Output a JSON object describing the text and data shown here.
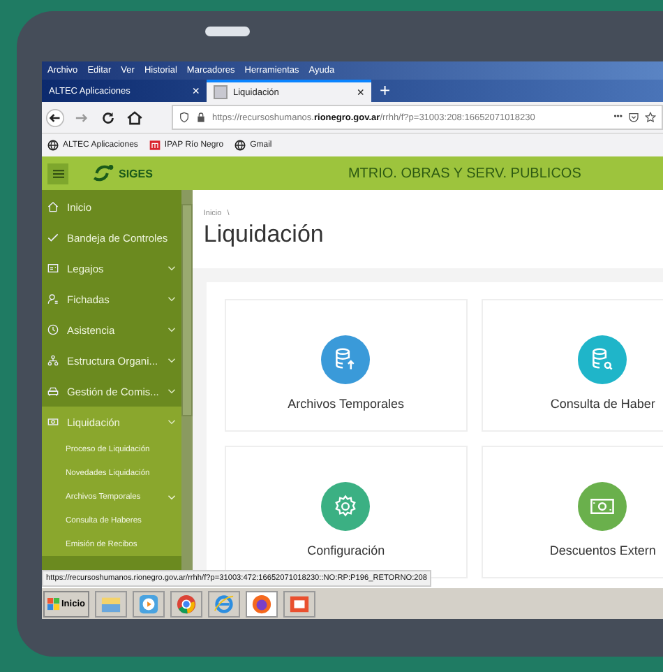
{
  "menu_bar": [
    "Archivo",
    "Editar",
    "Ver",
    "Historial",
    "Marcadores",
    "Herramientas",
    "Ayuda"
  ],
  "tabs": [
    {
      "label": "ALTEC Aplicaciones",
      "close": "×",
      "selected": false
    },
    {
      "label": "Liquidación",
      "close": "×",
      "selected": true
    }
  ],
  "new_tab": "+",
  "address_bar": {
    "url": "https://recursoshumanos.**rionegro.gov.ar**/rrhh/f?p=31003:208:16652071018230",
    "more": "•••"
  },
  "bookmarks": [
    {
      "label": "ALTEC Aplicaciones",
      "kind": "globe"
    },
    {
      "label": "IPAP Río Negro",
      "kind": "ipap"
    },
    {
      "label": "Gmail",
      "kind": "globe"
    }
  ],
  "header": {
    "logo": "SIGES",
    "organization": "MTRIO. OBRAS Y SERV. PUBLICOS"
  },
  "sidebar": {
    "items": [
      {
        "label": "Inicio",
        "kind": "home",
        "expandable": false,
        "selected": false
      },
      {
        "label": "Bandeja de Controles",
        "kind": "check",
        "expandable": false,
        "selected": false
      },
      {
        "label": "Legajos",
        "kind": "card",
        "expandable": true,
        "selected": false
      },
      {
        "label": "Fichadas",
        "kind": "user",
        "expandable": true,
        "selected": false
      },
      {
        "label": "Asistencia",
        "kind": "clock",
        "expandable": true,
        "selected": false
      },
      {
        "label": "Estructura Organi...",
        "kind": "tree",
        "expandable": true,
        "selected": false
      },
      {
        "label": "Gestión de Comis...",
        "kind": "car",
        "expandable": true,
        "selected": false
      },
      {
        "label": "Liquidación",
        "kind": "money",
        "expandable": true,
        "selected": true,
        "children": [
          {
            "label": "Proceso de Liquidación",
            "kind": "link"
          },
          {
            "label": "Novedades Liquidación",
            "kind": "link"
          },
          {
            "label": "Archivos Temporales",
            "kind": "group"
          },
          {
            "label": "Consulta de Haberes",
            "kind": "link"
          },
          {
            "label": "Emisión de Recibos",
            "kind": "link"
          }
        ]
      }
    ]
  },
  "breadcrumb": [
    "Inicio",
    "\\"
  ],
  "page_title": "Liquidación",
  "cards": [
    {
      "label": "Archivos Temporales",
      "kind": "database-upload",
      "color": "#3a9ad9"
    },
    {
      "label": "Consulta de Haber",
      "kind": "database-search",
      "color": "#1fb5c9"
    },
    {
      "label": "Configuración",
      "kind": "gear",
      "color": "#3bb083"
    },
    {
      "label": "Descuentos Extern",
      "kind": "money",
      "color": "#6ab04c"
    }
  ],
  "status_url": "https://recursoshumanos.rionegro.gov.ar/rrhh/f?p=31003:472:16652071018230::NO:RP:P196_RETORNO:208",
  "taskbar": {
    "start": "Inicio",
    "apps": [
      {
        "kind": "folder",
        "selected": false
      },
      {
        "kind": "player",
        "selected": false
      },
      {
        "kind": "chrome",
        "selected": false
      },
      {
        "kind": "ie",
        "selected": false
      },
      {
        "kind": "firefox",
        "selected": true
      },
      {
        "kind": "slides",
        "selected": false
      }
    ]
  }
}
